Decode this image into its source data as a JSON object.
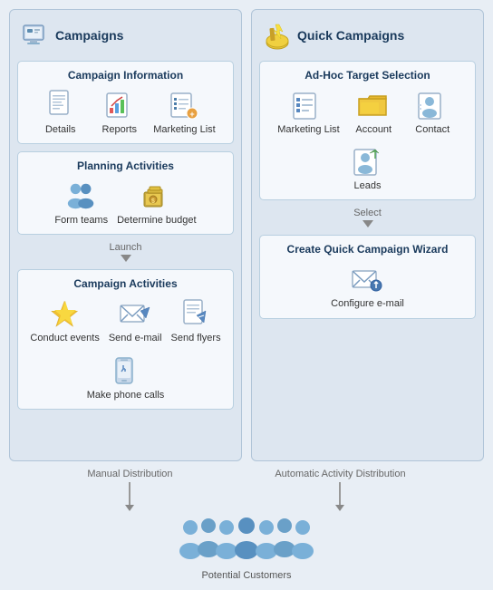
{
  "campaigns_panel": {
    "title": "Campaigns",
    "campaign_info": {
      "title": "Campaign Information",
      "items": [
        {
          "label": "Details",
          "icon": "details-icon"
        },
        {
          "label": "Reports",
          "icon": "reports-icon"
        },
        {
          "label": "Marketing List",
          "icon": "marketing-list-icon"
        }
      ]
    },
    "planning": {
      "title": "Planning Activities",
      "items": [
        {
          "label": "Form teams",
          "icon": "form-teams-icon"
        },
        {
          "label": "Determine budget",
          "icon": "determine-budget-icon"
        }
      ]
    },
    "launch_label": "Launch",
    "activities": {
      "title": "Campaign Activities",
      "items": [
        {
          "label": "Conduct events",
          "icon": "conduct-events-icon"
        },
        {
          "label": "Send e-mail",
          "icon": "send-email-icon"
        },
        {
          "label": "Send flyers",
          "icon": "send-flyers-icon"
        },
        {
          "label": "Make phone calls",
          "icon": "make-phone-calls-icon"
        }
      ]
    }
  },
  "quick_campaigns_panel": {
    "title": "Quick Campaigns",
    "adhoc": {
      "title": "Ad-Hoc Target Selection",
      "items": [
        {
          "label": "Marketing List",
          "icon": "marketing-list2-icon"
        },
        {
          "label": "Account",
          "icon": "account-icon"
        },
        {
          "label": "Contact",
          "icon": "contact-icon"
        },
        {
          "label": "Leads",
          "icon": "leads-icon"
        }
      ]
    },
    "select_label": "Select",
    "wizard": {
      "title": "Create Quick Campaign Wizard",
      "items": [
        {
          "label": "Configure e-mail",
          "icon": "configure-email-icon"
        }
      ]
    }
  },
  "bottom": {
    "left_label": "Manual Distribution",
    "right_label": "Automatic Activity Distribution",
    "customers_label": "Potential Customers"
  }
}
